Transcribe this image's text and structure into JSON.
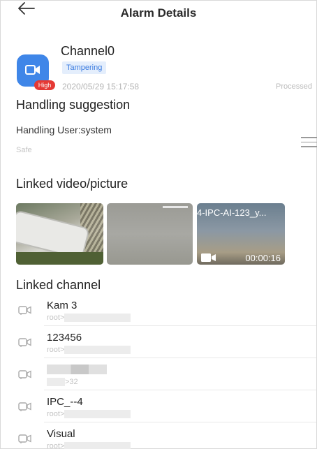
{
  "header": {
    "title": "Alarm Details"
  },
  "alarm": {
    "channel_name": "Channel0",
    "event_type": "Tampering",
    "priority": "High",
    "time": "2020/05/29 15:17:58",
    "status": "Processed"
  },
  "suggestion": {
    "heading": "Handling suggestion",
    "user": "Handling User:system",
    "note": "Safe"
  },
  "linked_media": {
    "heading": "Linked video/picture",
    "video_filename": "4-IPC-AI-123_y...",
    "video_duration": "00:00:16"
  },
  "linked_channels": {
    "heading": "Linked channel",
    "items": [
      {
        "name": "Kam 3",
        "path": "root>"
      },
      {
        "name": "123456",
        "path": "root>"
      },
      {
        "name": "",
        "path": ">32"
      },
      {
        "name": "IPC_--4",
        "path": "root>"
      },
      {
        "name": "Visual",
        "path": "root>"
      }
    ]
  },
  "colors": {
    "accent": "#3f86e8",
    "priority_badge": "#e53935",
    "tag_bg": "#e4eefc"
  },
  "icons": [
    "back-arrow-icon",
    "camera-icon",
    "menu-icon",
    "video-camera-icon"
  ]
}
